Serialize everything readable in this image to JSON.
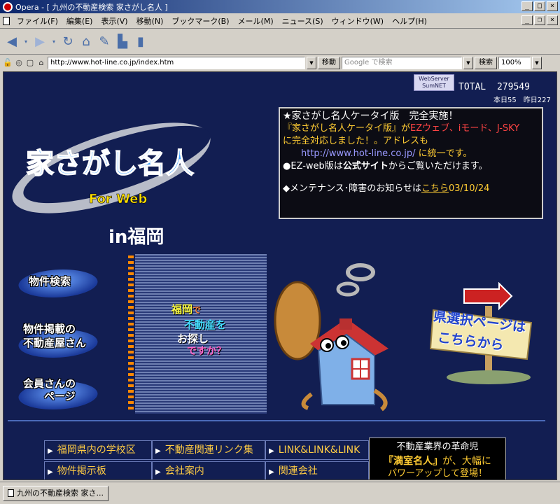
{
  "window": {
    "title": "Opera - [ 九州の不動産検索 家さがし名人 ]"
  },
  "menu": [
    "ファイル(F)",
    "編集(E)",
    "表示(V)",
    "移動(N)",
    "ブックマーク(B)",
    "メール(M)",
    "ニュース(S)",
    "ウィンドウ(W)",
    "ヘルプ(H)"
  ],
  "address": {
    "url": "http://www.hot-line.co.jp/index.htm",
    "go_label": "移動",
    "search_placeholder": "Google で検索",
    "search_label": "検索",
    "zoom": "100%"
  },
  "page": {
    "webserver": "WebServer SumNET",
    "total_label": "TOTAL",
    "total_value": "279549",
    "counts": "本日55　昨日227",
    "news": {
      "headline": "★家さがし名人ケータイ版　完全実施！",
      "line1_a": "『家さがし名人ケータイ版』が",
      "line1_b": "EZウェブ、iモード、J-SKY",
      "line2": "に完全対応しました！。アドレスも",
      "url": "http://www.hot-line.co.jp/",
      "url_suffix": "に統一です。",
      "ezweb_a": "●",
      "ezweb_b": "EZ-web版",
      "ezweb_c": "は",
      "ezweb_d": "公式サイト",
      "ezweb_e": "からご覧いただけます。",
      "maint_a": "◆メンテナンス･障害のお知らせは",
      "maint_link": "こちら",
      "maint_date": "03/10/24"
    },
    "logo_title": "家さがし名人",
    "logo_sub": "For Web",
    "region": "in福岡",
    "side_buttons": [
      "物件検索",
      "物件掲載の",
      "不動産屋さん",
      "会員さんの",
      "ページ"
    ],
    "tagline": [
      "福岡",
      "で",
      "不動産",
      "を",
      "お探し",
      "ですか？"
    ],
    "sign": [
      "県選択ページは",
      "こちらから"
    ],
    "links": [
      "福岡県内の学校区",
      "不動産関連リンク集",
      "LINK&LINK&LINK",
      "物件掲示板",
      "会社案内",
      "関連会社"
    ],
    "promo": [
      "不動産業界の革命児",
      "『満室名人』",
      "が、大幅に",
      "パワーアップして登場！"
    ]
  },
  "statusbar": {
    "tab_label": "九州の不動産検索 家さ..."
  }
}
